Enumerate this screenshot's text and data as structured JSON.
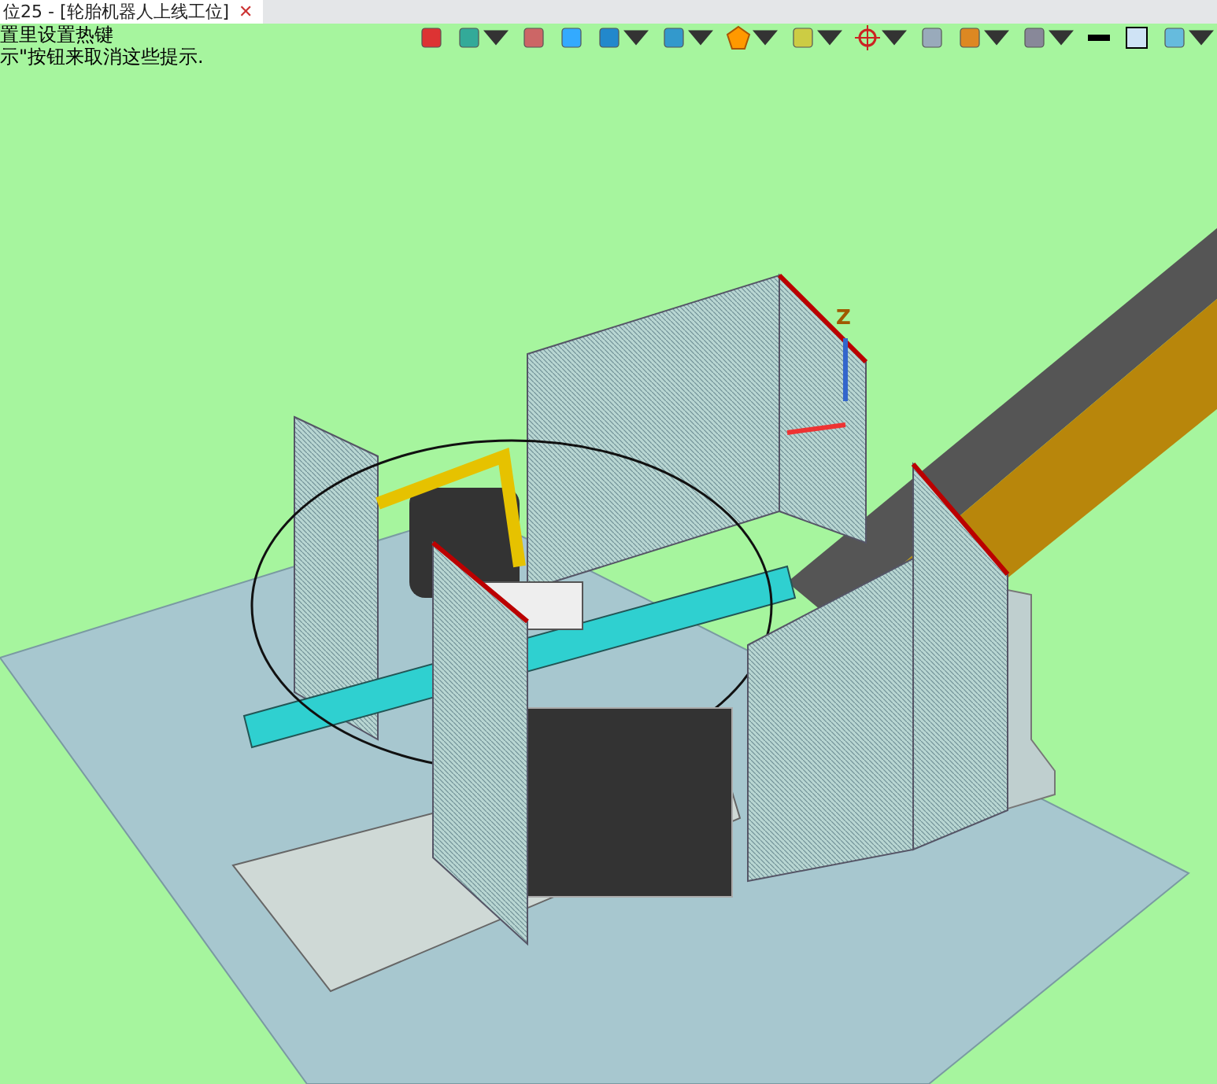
{
  "tabs": [
    {
      "label": "位25 - [轮胎机器人上线工位]",
      "close": "✕",
      "selected": true
    }
  ],
  "hints": [
    "置里设置热键",
    "示\"按钮来取消这些提示."
  ],
  "viewport": {
    "axis_label": "Z"
  }
}
